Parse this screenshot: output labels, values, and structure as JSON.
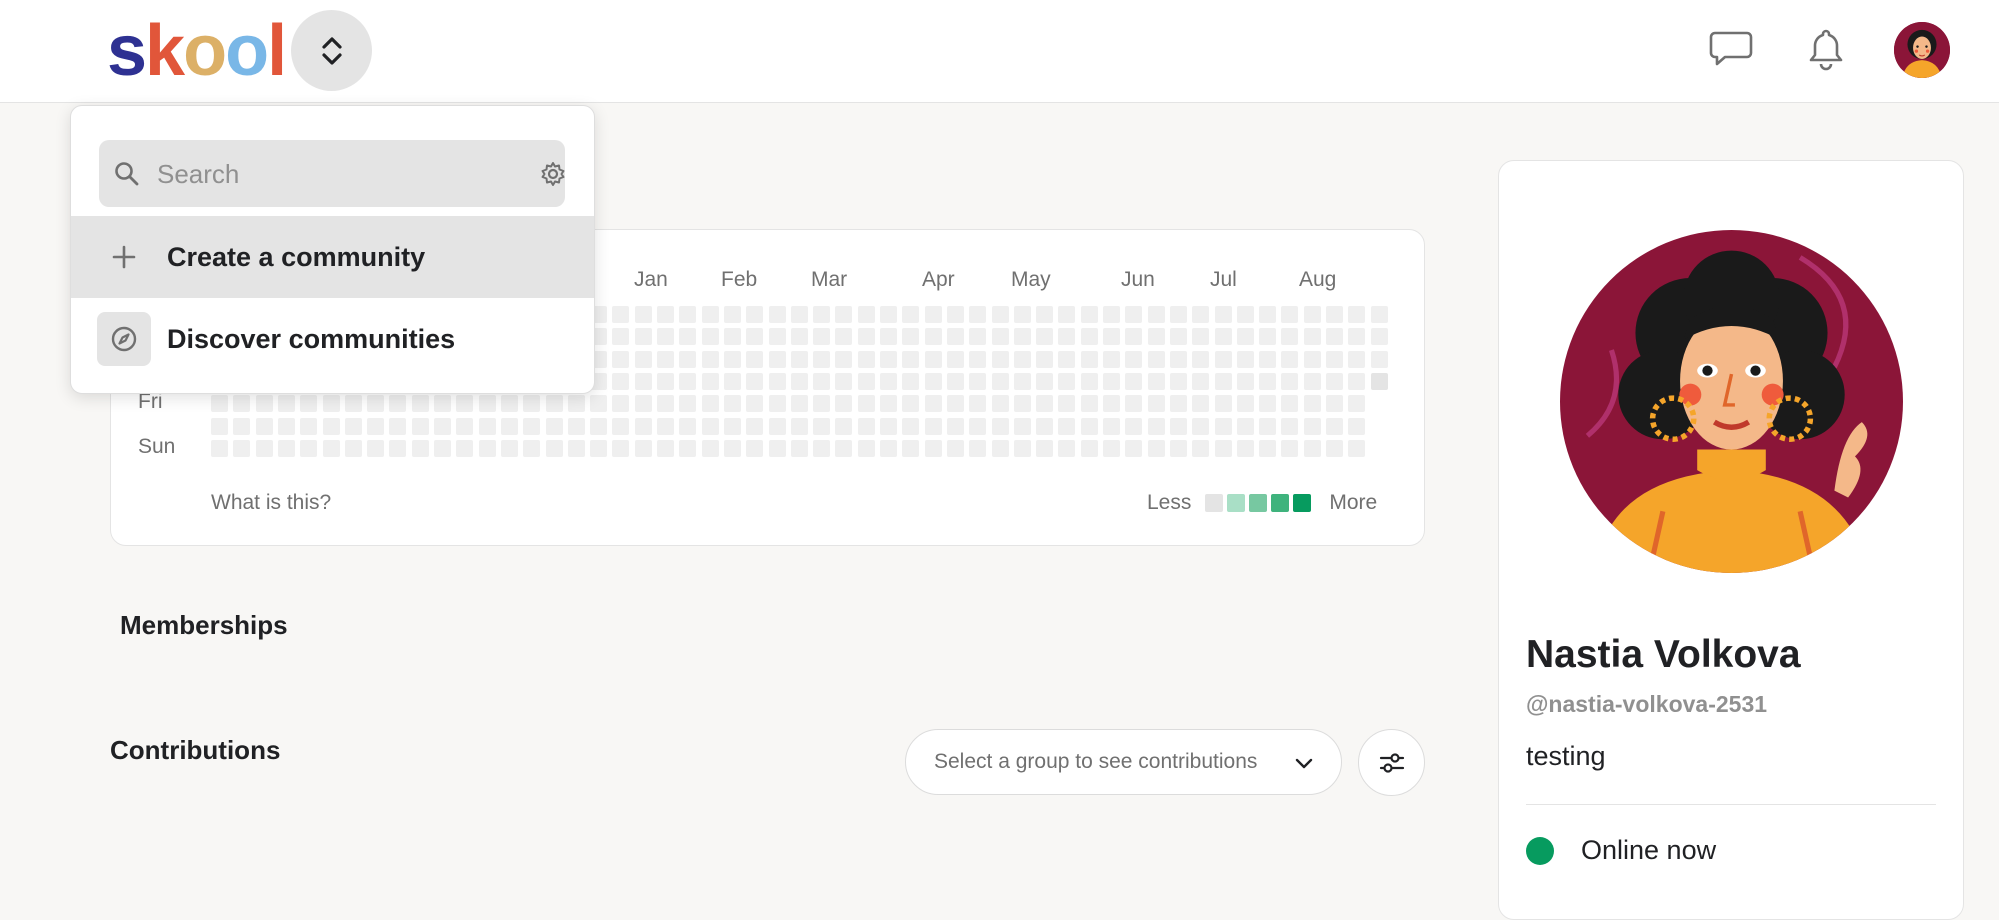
{
  "header": {
    "logo_letters": [
      "s",
      "k",
      "o",
      "o",
      "l"
    ],
    "logo_colors": [
      "#2e3192",
      "#e1563a",
      "#dcb067",
      "#79b7e7",
      "#e1563a"
    ],
    "chat_icon": "chat-bubble-icon",
    "bell_icon": "bell-icon"
  },
  "dropdown": {
    "search_placeholder": "Search",
    "search_value": "",
    "create_label": "Create a community",
    "discover_label": "Discover communities"
  },
  "activity": {
    "months": [
      "Jan",
      "Feb",
      "Mar",
      "Apr",
      "May",
      "Jun",
      "Jul",
      "Aug"
    ],
    "days": [
      "Fri",
      "Sun"
    ],
    "what_is_this": "What is this?",
    "legend_less": "Less",
    "legend_more": "More",
    "legend_colors": [
      "#e4e4e4",
      "#a9dfc6",
      "#77c8a1",
      "#3fb37d",
      "#079b5f"
    ],
    "empty_color": "#efefef",
    "weeks_visible": 53,
    "rows_visible": 7
  },
  "sections": {
    "memberships": "Memberships",
    "contributions": "Contributions",
    "group_select_placeholder": "Select a group to see contributions"
  },
  "profile": {
    "name": "Nastia Volkova",
    "handle": "@nastia-volkova-2531",
    "bio": "testing",
    "status": "Online now",
    "status_color": "#079b5f"
  }
}
